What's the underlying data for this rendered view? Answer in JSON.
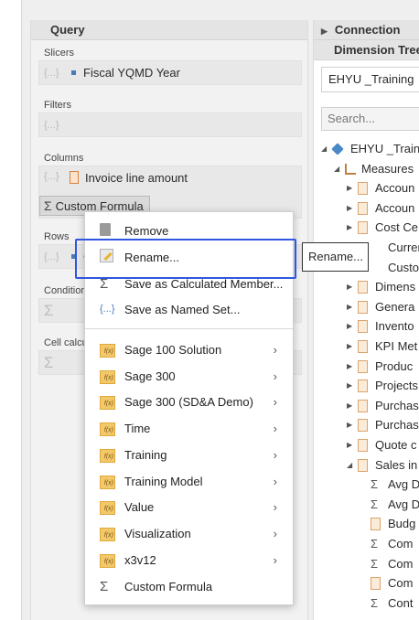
{
  "query": {
    "title": "Query",
    "slicers_label": "Slicers",
    "slicer_item": "Fiscal YQMD Year",
    "filters_label": "Filters",
    "columns_label": "Columns",
    "column_item": "Invoice line amount",
    "custom_formula_chip": "Custom Formula",
    "rows_label": "Rows",
    "rows_item_fragment": "C",
    "conditions_label": "Condition",
    "cell_calc_label": "Cell calcu",
    "braces_glyph": "{...}",
    "sigma_glyph": "Σ"
  },
  "connection": {
    "title": "Connection",
    "dimension_tree_title": "Dimension Tree",
    "connection_value": "EHYU _Training",
    "search_placeholder": "Search...",
    "tree": [
      {
        "label": "EHYU _Train",
        "icon": "cube-icon"
      },
      {
        "label": "Measures",
        "icon": "measures-icon"
      },
      {
        "label": "Accoun",
        "icon": "file-icon"
      },
      {
        "label": "Accoun",
        "icon": "file-icon"
      },
      {
        "label": "Cost Ce",
        "icon": "file-icon"
      },
      {
        "label": "Curren",
        "icon": "none"
      },
      {
        "label": "Custom",
        "icon": "none"
      },
      {
        "label": "Dimens",
        "icon": "file-icon"
      },
      {
        "label": "Genera",
        "icon": "file-icon"
      },
      {
        "label": "Invento",
        "icon": "file-icon"
      },
      {
        "label": "KPI Met",
        "icon": "file-icon"
      },
      {
        "label": "Produc",
        "icon": "file-icon"
      },
      {
        "label": "Projects",
        "icon": "file-icon"
      },
      {
        "label": "Purchas",
        "icon": "file-icon"
      },
      {
        "label": "Purchas",
        "icon": "file-icon"
      },
      {
        "label": "Quote c",
        "icon": "file-icon"
      },
      {
        "label": "Sales in",
        "icon": "file-icon"
      },
      {
        "label": "Avg D",
        "icon": "sigma-icon"
      },
      {
        "label": "Avg D",
        "icon": "sigma-icon"
      },
      {
        "label": "Budg",
        "icon": "file-icon"
      },
      {
        "label": "Com",
        "icon": "sigma-icon"
      },
      {
        "label": "Com",
        "icon": "sigma-icon"
      },
      {
        "label": "Com",
        "icon": "file-icon"
      },
      {
        "label": "Cont",
        "icon": "sigma-icon"
      }
    ]
  },
  "context_menu": {
    "items": [
      {
        "label": "Remove"
      },
      {
        "label": "Rename..."
      },
      {
        "label": "Save as Calculated Member..."
      },
      {
        "label": "Save as Named Set..."
      },
      {
        "label": "Sage 100 Solution"
      },
      {
        "label": "Sage 300"
      },
      {
        "label": "Sage 300 (SD&A Demo)"
      },
      {
        "label": "Time"
      },
      {
        "label": "Training"
      },
      {
        "label": "Training Model"
      },
      {
        "label": "Value"
      },
      {
        "label": "Visualization"
      },
      {
        "label": "x3v12"
      },
      {
        "label": "Custom Formula"
      }
    ],
    "submenu_chevron": "›",
    "fx_glyph": "f(x)"
  },
  "tooltip": {
    "text": "Rename..."
  },
  "colors": {
    "highlight": "#2f57e0",
    "accent_blue": "#4a7ab7",
    "panel_bg": "#f2f2f2"
  }
}
